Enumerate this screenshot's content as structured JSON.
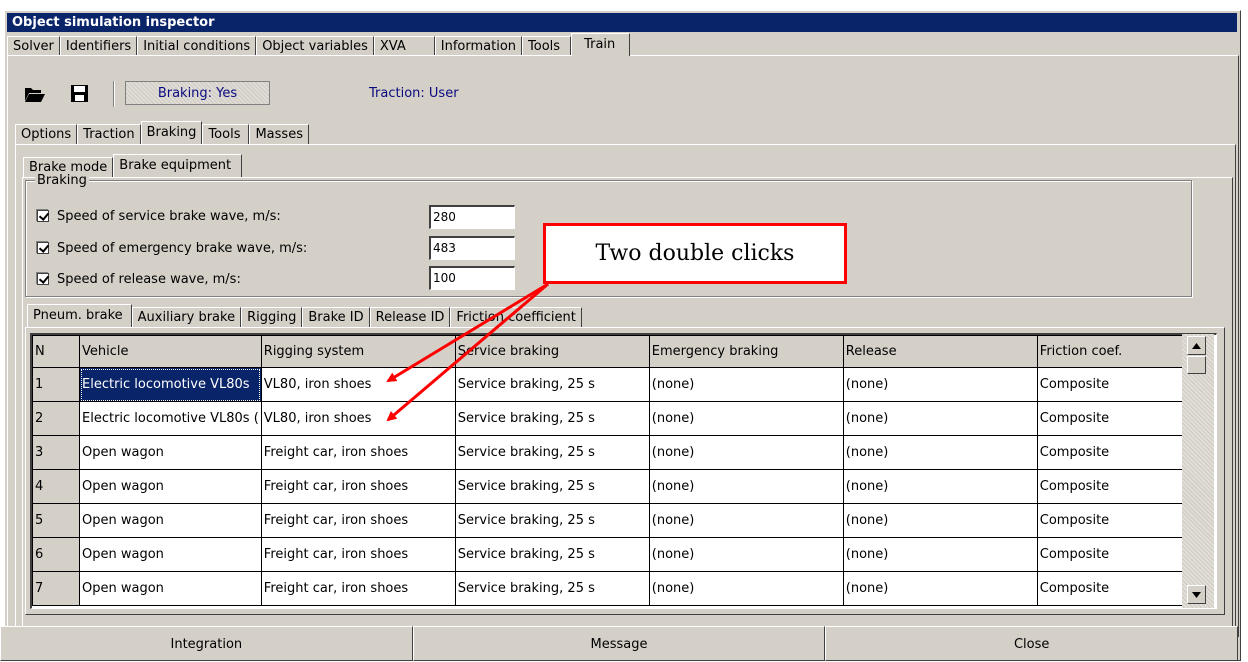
{
  "window_title": "Object simulation inspector",
  "top_tabs": [
    "Solver",
    "Identifiers",
    "Initial conditions",
    "Object variables",
    "XVA",
    "Information",
    "Tools",
    "Train"
  ],
  "toolbar": {
    "open_icon": "folder-open-icon",
    "save_icon": "save-disk-icon",
    "braking_status": "Braking: Yes",
    "traction_status": "Traction: User"
  },
  "train_tabs": [
    "Options",
    "Traction",
    "Braking",
    "Tools",
    "Masses"
  ],
  "braking_tabs": [
    "Brake mode",
    "Brake equipment"
  ],
  "braking_group": {
    "legend": "Braking",
    "rows": [
      {
        "label": "Speed of service brake wave, m/s:",
        "checked": true,
        "value": "280"
      },
      {
        "label": "Speed of emergency brake wave, m/s:",
        "checked": true,
        "value": "483"
      },
      {
        "label": "Speed of release wave, m/s:",
        "checked": true,
        "value": "100"
      }
    ]
  },
  "equipment_tabs": [
    "Pneum. brake",
    "Auxiliary brake",
    "Rigging",
    "Brake ID",
    "Release ID",
    "Friction coefficient"
  ],
  "table": {
    "headers": [
      "N",
      "Vehicle",
      "Rigging system",
      "Service braking",
      "Emergency braking",
      "Release",
      "Friction coef."
    ],
    "rows": [
      [
        "1",
        "Electric locomotive VL80s",
        "VL80, iron shoes",
        "Service braking, 25 s",
        "(none)",
        "(none)",
        "Composite"
      ],
      [
        "2",
        "Electric locomotive VL80s (",
        "VL80, iron shoes",
        "Service braking, 25 s",
        "(none)",
        "(none)",
        "Composite"
      ],
      [
        "3",
        "Open wagon",
        "Freight car, iron shoes",
        "Service braking, 25 s",
        "(none)",
        "(none)",
        "Composite"
      ],
      [
        "4",
        "Open wagon",
        "Freight car, iron shoes",
        "Service braking, 25 s",
        "(none)",
        "(none)",
        "Composite"
      ],
      [
        "5",
        "Open wagon",
        "Freight car, iron shoes",
        "Service braking, 25 s",
        "(none)",
        "(none)",
        "Composite"
      ],
      [
        "6",
        "Open wagon",
        "Freight car, iron shoes",
        "Service braking, 25 s",
        "(none)",
        "(none)",
        "Composite"
      ],
      [
        "7",
        "Open wagon",
        "Freight car, iron shoes",
        "Service braking, 25 s",
        "(none)",
        "(none)",
        "Composite"
      ]
    ]
  },
  "bottom_buttons": [
    "Integration",
    "Message",
    "Close"
  ],
  "annotation": {
    "text": "Two double clicks",
    "color": "#ff0000"
  }
}
